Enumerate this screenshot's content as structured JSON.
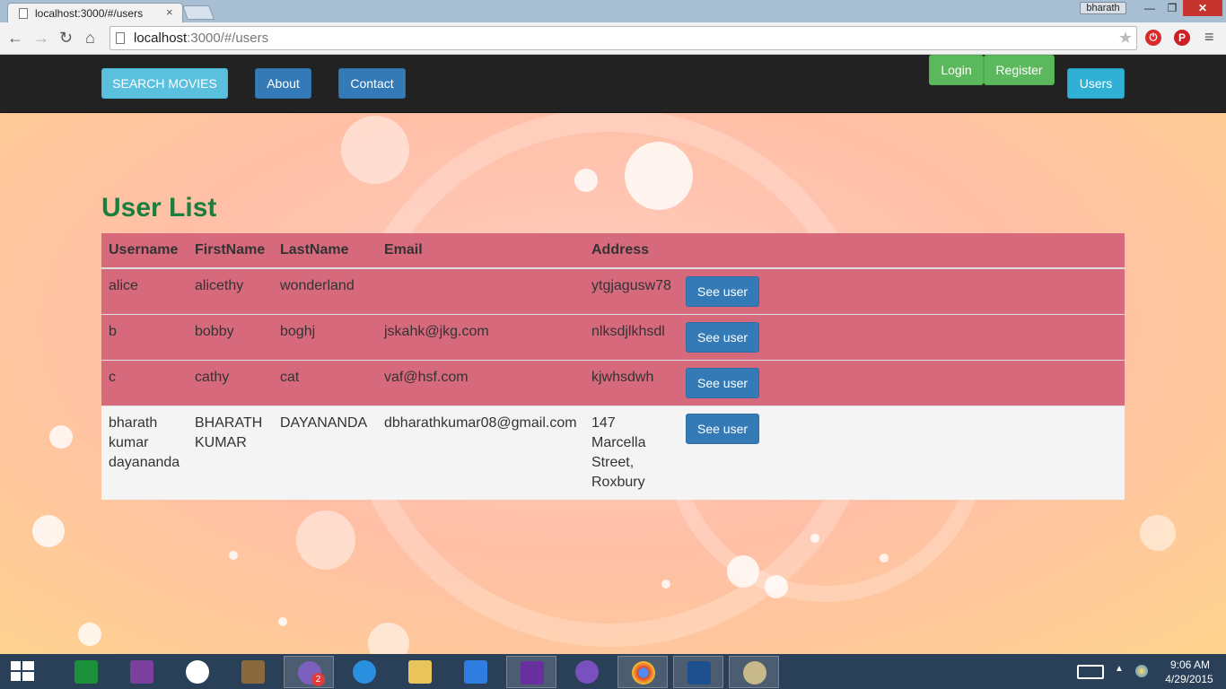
{
  "browser": {
    "tab_title": "localhost:3000/#/users",
    "profile_name": "bharath",
    "url_host": "localhost",
    "url_path": ":3000/#/users"
  },
  "navbar": {
    "search_movies": "SEARCH MOVIES",
    "about": "About",
    "contact": "Contact",
    "login": "Login",
    "register": "Register",
    "users": "Users"
  },
  "page": {
    "heading": "User List",
    "table": {
      "columns": [
        "Username",
        "FirstName",
        "LastName",
        "Email",
        "Address",
        ""
      ],
      "rows": [
        {
          "username": "alice",
          "firstname": "alicethy",
          "lastname": "wonderland",
          "email": "",
          "address": "ytgjagusw78",
          "action": "See user"
        },
        {
          "username": "b",
          "firstname": "bobby",
          "lastname": "boghj",
          "email": "jskahk@jkg.com",
          "address": "nlksdjlkhsdl",
          "action": "See user"
        },
        {
          "username": "c",
          "firstname": "cathy",
          "lastname": "cat",
          "email": "vaf@hsf.com",
          "address": "kjwhsdwh",
          "action": "See user"
        },
        {
          "username": "bharath kumar dayananda",
          "firstname": "BHARATH KUMAR",
          "lastname": "DAYANANDA",
          "email": "dbharathkumar08@gmail.com",
          "address": "147 Marcella Street, Roxbury",
          "action": "See user"
        }
      ]
    }
  },
  "taskbar": {
    "viber_badge": "2",
    "time": "9:06 AM",
    "date": "4/29/2015"
  },
  "colors": {
    "heading": "#1a7f3e",
    "row_highlight": "#d6697c",
    "primary_button": "#337ab7",
    "success_button": "#5cb85c",
    "info_button": "#5bc0de"
  }
}
